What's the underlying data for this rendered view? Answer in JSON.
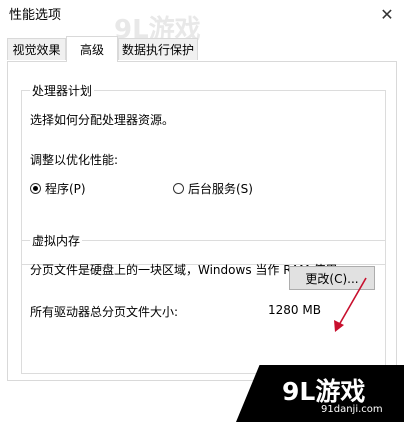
{
  "window": {
    "title": "性能选项"
  },
  "tabs": [
    {
      "label": "视觉效果"
    },
    {
      "label": "高级"
    },
    {
      "label": "数据执行保护"
    }
  ],
  "processor": {
    "legend": "处理器计划",
    "description": "选择如何分配处理器资源。",
    "adjust_label": "调整以优化性能:",
    "options": [
      {
        "label": "程序(P)",
        "checked": true
      },
      {
        "label": "后台服务(S)",
        "checked": false
      }
    ]
  },
  "virtual_memory": {
    "legend": "虚拟内存",
    "description": "分页文件是硬盘上的一块区域，Windows 当作 RAM 使用。",
    "size_label": "所有驱动器总分页文件大小:",
    "size_value": "1280 MB",
    "change_button": "更改(C)..."
  },
  "watermark": {
    "top_logo": "9L游戏",
    "bottom_logo": "9L游戏",
    "bottom_url": "91danji.com"
  },
  "colors": {
    "arrow": "#c8102e"
  }
}
